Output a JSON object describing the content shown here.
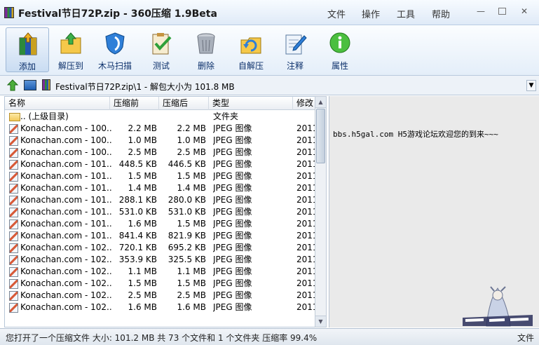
{
  "window": {
    "title": "Festival节日72P.zip - 360压缩 1.9Beta",
    "menu": [
      "文件",
      "操作",
      "工具",
      "帮助"
    ],
    "minimize": "—",
    "close": "✕"
  },
  "toolbar": {
    "add": "添加",
    "extract_to": "解压到",
    "trojan_scan": "木马扫描",
    "test": "测试",
    "delete": "删除",
    "self_extract": "自解压",
    "comment": "注释",
    "properties": "属性"
  },
  "address": {
    "path": "Festival节日72P.zip\\1 - 解包大小为 101.8 MB",
    "dropdown": "▼"
  },
  "columns": {
    "name": "名称",
    "packed": "压缩前",
    "size": "压缩后",
    "type": "类型",
    "modified": "修改日"
  },
  "parent_row": {
    "name": ".. (上级目录)",
    "type": "文件夹"
  },
  "files": [
    {
      "name": "Konachan.com - 100...",
      "packed": "2.2 MB",
      "size": "2.2 MB",
      "type": "JPEG 图像",
      "modified": "2011"
    },
    {
      "name": "Konachan.com - 100...",
      "packed": "1.0 MB",
      "size": "1.0 MB",
      "type": "JPEG 图像",
      "modified": "2011"
    },
    {
      "name": "Konachan.com - 100...",
      "packed": "2.5 MB",
      "size": "2.5 MB",
      "type": "JPEG 图像",
      "modified": "2011"
    },
    {
      "name": "Konachan.com - 101...",
      "packed": "448.5 KB",
      "size": "446.5 KB",
      "type": "JPEG 图像",
      "modified": "2011"
    },
    {
      "name": "Konachan.com - 101...",
      "packed": "1.5 MB",
      "size": "1.5 MB",
      "type": "JPEG 图像",
      "modified": "2011"
    },
    {
      "name": "Konachan.com - 101...",
      "packed": "1.4 MB",
      "size": "1.4 MB",
      "type": "JPEG 图像",
      "modified": "2011"
    },
    {
      "name": "Konachan.com - 101...",
      "packed": "288.1 KB",
      "size": "280.0 KB",
      "type": "JPEG 图像",
      "modified": "2011"
    },
    {
      "name": "Konachan.com - 101...",
      "packed": "531.0 KB",
      "size": "531.0 KB",
      "type": "JPEG 图像",
      "modified": "2011"
    },
    {
      "name": "Konachan.com - 101...",
      "packed": "1.6 MB",
      "size": "1.5 MB",
      "type": "JPEG 图像",
      "modified": "2011"
    },
    {
      "name": "Konachan.com - 101...",
      "packed": "841.4 KB",
      "size": "821.9 KB",
      "type": "JPEG 图像",
      "modified": "2011"
    },
    {
      "name": "Konachan.com - 102...",
      "packed": "720.1 KB",
      "size": "695.2 KB",
      "type": "JPEG 图像",
      "modified": "2011"
    },
    {
      "name": "Konachan.com - 102...",
      "packed": "353.9 KB",
      "size": "325.5 KB",
      "type": "JPEG 图像",
      "modified": "2011"
    },
    {
      "name": "Konachan.com - 102...",
      "packed": "1.1 MB",
      "size": "1.1 MB",
      "type": "JPEG 图像",
      "modified": "2011"
    },
    {
      "name": "Konachan.com - 102...",
      "packed": "1.5 MB",
      "size": "1.5 MB",
      "type": "JPEG 图像",
      "modified": "2011"
    },
    {
      "name": "Konachan.com - 102...",
      "packed": "2.5 MB",
      "size": "2.5 MB",
      "type": "JPEG 图像",
      "modified": "2011"
    },
    {
      "name": "Konachan.com - 102...",
      "packed": "1.6 MB",
      "size": "1.6 MB",
      "type": "JPEG 图像",
      "modified": "2011"
    }
  ],
  "comment": {
    "text": "bbs.h5gal.com  H5游戏论坛欢迎您的到来~~~"
  },
  "status": {
    "text": "您打开了一个压缩文件 大小: 101.2 MB 共 73 个文件和 1 个文件夹 压缩率 99.4%",
    "right": "文件"
  }
}
